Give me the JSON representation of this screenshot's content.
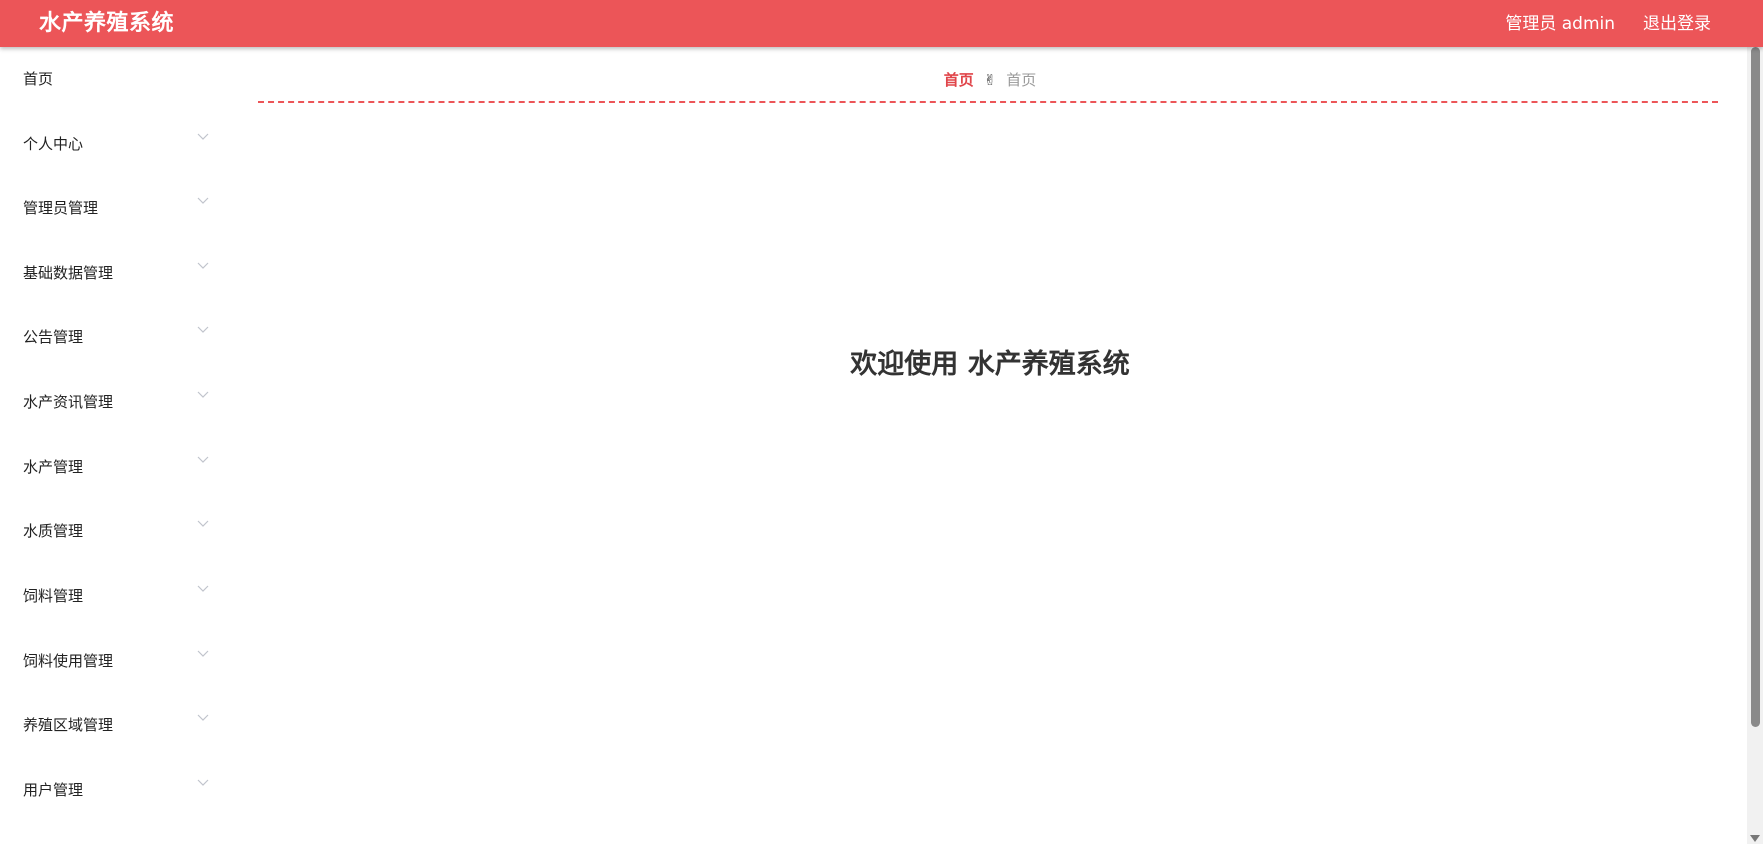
{
  "header": {
    "app_title": "水产养殖系统",
    "user_label": "管理员 admin",
    "logout_label": "退出登录",
    "bg_color": "#ec5558"
  },
  "sidebar": {
    "items": [
      {
        "label": "首页",
        "icon": null
      },
      {
        "label": "个人中心",
        "icon": "chevron-down-icon"
      },
      {
        "label": "管理员管理",
        "icon": "chevron-down-icon"
      },
      {
        "label": "基础数据管理",
        "icon": "chevron-down-icon"
      },
      {
        "label": "公告管理",
        "icon": "chevron-down-icon"
      },
      {
        "label": "水产资讯管理",
        "icon": "chevron-down-icon"
      },
      {
        "label": "水产管理",
        "icon": "chevron-down-icon"
      },
      {
        "label": "水质管理",
        "icon": "chevron-down-icon"
      },
      {
        "label": "饲料管理",
        "icon": "chevron-down-icon"
      },
      {
        "label": "饲料使用管理",
        "icon": "chevron-down-icon"
      },
      {
        "label": "养殖区域管理",
        "icon": "chevron-down-icon"
      },
      {
        "label": "用户管理",
        "icon": "chevron-down-icon"
      }
    ]
  },
  "breadcrumb": {
    "home": "首页",
    "separator_icon": "victory-hand-icon",
    "separator": "✌",
    "current": "首页"
  },
  "main": {
    "welcome_text": "欢迎使用 水产养殖系统"
  },
  "colors": {
    "accent": "#ec5558",
    "breadcrumb_active": "#e0454a"
  }
}
